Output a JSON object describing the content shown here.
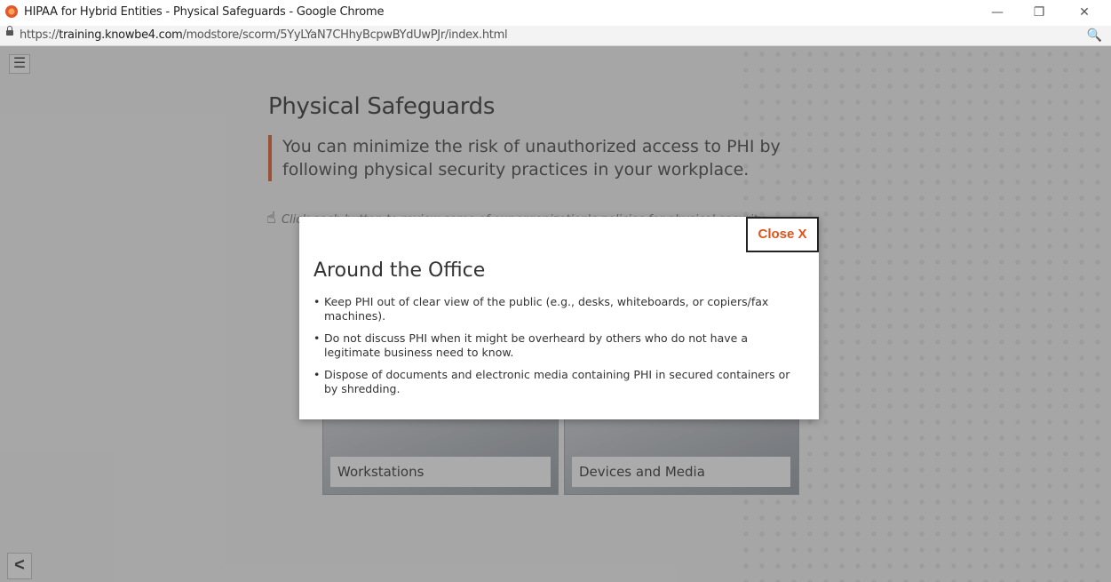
{
  "browser": {
    "window_title": "HIPAA for Hybrid Entities - Physical Safeguards - Google Chrome",
    "url_prefix": "https://",
    "url_domain": "training.knowbe4.com",
    "url_path": "/modstore/scorm/5YyLYaN7CHhyBcpwBYdUwPJr/index.html",
    "minimize_glyph": "—",
    "restore_glyph": "❐",
    "close_glyph": "✕",
    "zoom_glyph": "🔍"
  },
  "page": {
    "menu_glyph": "☰",
    "back_glyph": "<",
    "title": "Physical Safeguards",
    "quote": "You can minimize the risk of unauthorized access to PHI by following physical security practices in your workplace.",
    "instruction": "Click each button to review some of our organization's policies for physical security.",
    "cards": [
      {
        "label": "Workstations"
      },
      {
        "label": "Devices and Media"
      }
    ]
  },
  "modal": {
    "close_label": "Close X",
    "heading": "Around the Office",
    "bullets": [
      "Keep PHI out of clear view of the public (e.g., desks, whiteboards, or copiers/fax machines).",
      "Do not discuss PHI when it might be overheard by others who do not have a legitimate business need to know.",
      "Dispose of documents and electronic media containing PHI in secured containers or by shredding."
    ]
  }
}
